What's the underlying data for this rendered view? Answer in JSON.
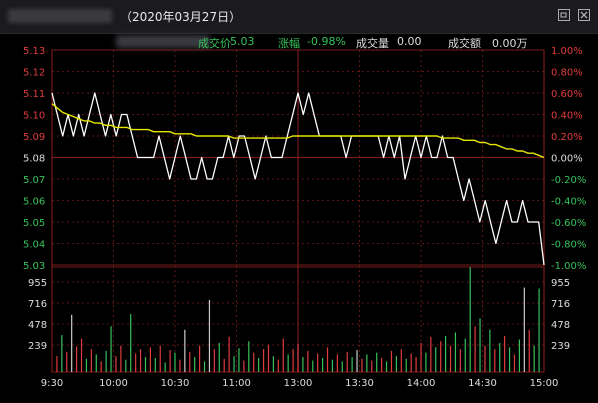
{
  "title": {
    "date_text": "（2020年03月27日）"
  },
  "window": {
    "restore_icon": "restore-icon",
    "close_icon": "close-icon"
  },
  "info": {
    "price_label": "成交价",
    "price_value": "5.03",
    "change_label": "涨幅",
    "change_value": "-0.98%",
    "volume_label": "成交量",
    "volume_value": "0.00",
    "amount_label": "成交额",
    "amount_value": "0.00万"
  },
  "colors": {
    "background": "#000000",
    "grid": "#7a1c1c",
    "up": "#e03c3c",
    "down": "#36c25a",
    "price_line": "#ffffff",
    "avg_line": "#e6e600",
    "neutral_text": "#dddddd"
  },
  "chart_data": {
    "type": "line",
    "prev_close": 5.08,
    "price_ticks": [
      "5.13",
      "5.12",
      "5.11",
      "5.10",
      "5.09",
      "5.08",
      "5.07",
      "5.06",
      "5.05",
      "5.04",
      "5.03"
    ],
    "pct_ticks": [
      "1.00%",
      "0.80%",
      "0.60%",
      "0.40%",
      "0.20%",
      "0.00%",
      "-0.20%",
      "-0.40%",
      "-0.60%",
      "-0.80%",
      "-1.00%"
    ],
    "volume_ticks": [
      "955",
      "716",
      "478",
      "239"
    ],
    "time_ticks": [
      "9:30",
      "10:00",
      "10:30",
      "11:00",
      "13:00",
      "13:30",
      "14:00",
      "14:30",
      "15:00"
    ],
    "ylim": [
      5.03,
      5.13
    ],
    "volume_max": 1194,
    "series": [
      {
        "key": "price",
        "values": [
          5.11,
          5.1,
          5.09,
          5.1,
          5.09,
          5.1,
          5.09,
          5.1,
          5.11,
          5.1,
          5.09,
          5.1,
          5.09,
          5.1,
          5.1,
          5.09,
          5.08,
          5.08,
          5.08,
          5.08,
          5.09,
          5.08,
          5.07,
          5.08,
          5.09,
          5.08,
          5.07,
          5.07,
          5.08,
          5.07,
          5.07,
          5.08,
          5.08,
          5.09,
          5.08,
          5.09,
          5.09,
          5.08,
          5.07,
          5.08,
          5.09,
          5.08,
          5.08,
          5.08,
          5.09,
          5.1,
          5.11,
          5.1,
          5.11,
          5.1,
          5.09,
          5.09,
          5.09,
          5.09,
          5.09,
          5.08,
          5.09,
          5.09,
          5.09,
          5.09,
          5.09,
          5.09,
          5.08,
          5.09,
          5.08,
          5.09,
          5.07,
          5.08,
          5.09,
          5.08,
          5.09,
          5.08,
          5.08,
          5.09,
          5.08,
          5.08,
          5.07,
          5.06,
          5.07,
          5.06,
          5.05,
          5.06,
          5.05,
          5.04,
          5.05,
          5.06,
          5.05,
          5.05,
          5.06,
          5.05,
          5.05,
          5.05,
          5.03
        ]
      },
      {
        "key": "avg",
        "values": [
          5.105,
          5.103,
          5.101,
          5.1,
          5.099,
          5.098,
          5.097,
          5.097,
          5.096,
          5.096,
          5.095,
          5.095,
          5.094,
          5.094,
          5.094,
          5.093,
          5.093,
          5.093,
          5.093,
          5.092,
          5.092,
          5.092,
          5.092,
          5.091,
          5.091,
          5.091,
          5.091,
          5.09,
          5.09,
          5.09,
          5.09,
          5.09,
          5.09,
          5.09,
          5.089,
          5.089,
          5.089,
          5.089,
          5.089,
          5.089,
          5.089,
          5.089,
          5.089,
          5.089,
          5.089,
          5.09,
          5.09,
          5.09,
          5.09,
          5.09,
          5.09,
          5.09,
          5.09,
          5.09,
          5.09,
          5.09,
          5.09,
          5.09,
          5.09,
          5.09,
          5.09,
          5.09,
          5.09,
          5.09,
          5.09,
          5.09,
          5.09,
          5.09,
          5.09,
          5.09,
          5.09,
          5.09,
          5.09,
          5.089,
          5.089,
          5.089,
          5.089,
          5.088,
          5.088,
          5.088,
          5.087,
          5.087,
          5.086,
          5.086,
          5.085,
          5.084,
          5.084,
          5.083,
          5.083,
          5.082,
          5.082,
          5.081,
          5.08
        ]
      }
    ],
    "volumes": [
      {
        "t": 0.01,
        "v": 180,
        "d": "u"
      },
      {
        "t": 0.02,
        "v": 420,
        "d": "d"
      },
      {
        "t": 0.03,
        "v": 230,
        "d": "u"
      },
      {
        "t": 0.04,
        "v": 650,
        "d": "n"
      },
      {
        "t": 0.05,
        "v": 290,
        "d": "u"
      },
      {
        "t": 0.06,
        "v": 380,
        "d": "u"
      },
      {
        "t": 0.07,
        "v": 150,
        "d": "d"
      },
      {
        "t": 0.08,
        "v": 260,
        "d": "u"
      },
      {
        "t": 0.09,
        "v": 200,
        "d": "d"
      },
      {
        "t": 0.1,
        "v": 120,
        "d": "u"
      },
      {
        "t": 0.11,
        "v": 240,
        "d": "d"
      },
      {
        "t": 0.12,
        "v": 520,
        "d": "d"
      },
      {
        "t": 0.13,
        "v": 180,
        "d": "u"
      },
      {
        "t": 0.14,
        "v": 300,
        "d": "u"
      },
      {
        "t": 0.15,
        "v": 140,
        "d": "d"
      },
      {
        "t": 0.16,
        "v": 660,
        "d": "d"
      },
      {
        "t": 0.17,
        "v": 210,
        "d": "u"
      },
      {
        "t": 0.18,
        "v": 260,
        "d": "u"
      },
      {
        "t": 0.19,
        "v": 170,
        "d": "d"
      },
      {
        "t": 0.2,
        "v": 280,
        "d": "u"
      },
      {
        "t": 0.21,
        "v": 160,
        "d": "d"
      },
      {
        "t": 0.22,
        "v": 300,
        "d": "u"
      },
      {
        "t": 0.23,
        "v": 110,
        "d": "d"
      },
      {
        "t": 0.24,
        "v": 250,
        "d": "u"
      },
      {
        "t": 0.25,
        "v": 220,
        "d": "d"
      },
      {
        "t": 0.26,
        "v": 140,
        "d": "u"
      },
      {
        "t": 0.27,
        "v": 480,
        "d": "n"
      },
      {
        "t": 0.28,
        "v": 230,
        "d": "u"
      },
      {
        "t": 0.29,
        "v": 170,
        "d": "d"
      },
      {
        "t": 0.3,
        "v": 300,
        "d": "u"
      },
      {
        "t": 0.31,
        "v": 120,
        "d": "d"
      },
      {
        "t": 0.32,
        "v": 820,
        "d": "n"
      },
      {
        "t": 0.33,
        "v": 260,
        "d": "u"
      },
      {
        "t": 0.34,
        "v": 330,
        "d": "d"
      },
      {
        "t": 0.35,
        "v": 150,
        "d": "u"
      },
      {
        "t": 0.36,
        "v": 400,
        "d": "u"
      },
      {
        "t": 0.37,
        "v": 180,
        "d": "d"
      },
      {
        "t": 0.38,
        "v": 270,
        "d": "d"
      },
      {
        "t": 0.39,
        "v": 130,
        "d": "u"
      },
      {
        "t": 0.4,
        "v": 350,
        "d": "d"
      },
      {
        "t": 0.41,
        "v": 220,
        "d": "u"
      },
      {
        "t": 0.42,
        "v": 160,
        "d": "d"
      },
      {
        "t": 0.43,
        "v": 260,
        "d": "u"
      },
      {
        "t": 0.44,
        "v": 310,
        "d": "u"
      },
      {
        "t": 0.45,
        "v": 180,
        "d": "d"
      },
      {
        "t": 0.46,
        "v": 140,
        "d": "u"
      },
      {
        "t": 0.47,
        "v": 380,
        "d": "u"
      },
      {
        "t": 0.48,
        "v": 200,
        "d": "d"
      },
      {
        "t": 0.49,
        "v": 260,
        "d": "u"
      },
      {
        "t": 0.5,
        "v": 320,
        "d": "u"
      },
      {
        "t": 0.51,
        "v": 170,
        "d": "d"
      },
      {
        "t": 0.52,
        "v": 240,
        "d": "u"
      },
      {
        "t": 0.53,
        "v": 130,
        "d": "d"
      },
      {
        "t": 0.54,
        "v": 210,
        "d": "u"
      },
      {
        "t": 0.55,
        "v": 160,
        "d": "d"
      },
      {
        "t": 0.56,
        "v": 280,
        "d": "u"
      },
      {
        "t": 0.57,
        "v": 140,
        "d": "d"
      },
      {
        "t": 0.58,
        "v": 200,
        "d": "u"
      },
      {
        "t": 0.59,
        "v": 120,
        "d": "d"
      },
      {
        "t": 0.6,
        "v": 230,
        "d": "u"
      },
      {
        "t": 0.61,
        "v": 170,
        "d": "d"
      },
      {
        "t": 0.62,
        "v": 250,
        "d": "n"
      },
      {
        "t": 0.63,
        "v": 150,
        "d": "u"
      },
      {
        "t": 0.64,
        "v": 200,
        "d": "d"
      },
      {
        "t": 0.65,
        "v": 130,
        "d": "u"
      },
      {
        "t": 0.66,
        "v": 220,
        "d": "d"
      },
      {
        "t": 0.67,
        "v": 160,
        "d": "u"
      },
      {
        "t": 0.68,
        "v": 120,
        "d": "d"
      },
      {
        "t": 0.69,
        "v": 240,
        "d": "u"
      },
      {
        "t": 0.7,
        "v": 180,
        "d": "d"
      },
      {
        "t": 0.71,
        "v": 260,
        "d": "u"
      },
      {
        "t": 0.72,
        "v": 150,
        "d": "d"
      },
      {
        "t": 0.73,
        "v": 210,
        "d": "u"
      },
      {
        "t": 0.74,
        "v": 170,
        "d": "u"
      },
      {
        "t": 0.75,
        "v": 330,
        "d": "u"
      },
      {
        "t": 0.76,
        "v": 220,
        "d": "d"
      },
      {
        "t": 0.77,
        "v": 400,
        "d": "u"
      },
      {
        "t": 0.78,
        "v": 280,
        "d": "d"
      },
      {
        "t": 0.79,
        "v": 350,
        "d": "u"
      },
      {
        "t": 0.8,
        "v": 410,
        "d": "d"
      },
      {
        "t": 0.81,
        "v": 300,
        "d": "u"
      },
      {
        "t": 0.82,
        "v": 450,
        "d": "d"
      },
      {
        "t": 0.83,
        "v": 260,
        "d": "u"
      },
      {
        "t": 0.84,
        "v": 380,
        "d": "d"
      },
      {
        "t": 0.85,
        "v": 1190,
        "d": "d"
      },
      {
        "t": 0.86,
        "v": 520,
        "d": "u"
      },
      {
        "t": 0.87,
        "v": 610,
        "d": "d"
      },
      {
        "t": 0.88,
        "v": 300,
        "d": "u"
      },
      {
        "t": 0.89,
        "v": 480,
        "d": "d"
      },
      {
        "t": 0.9,
        "v": 260,
        "d": "u"
      },
      {
        "t": 0.91,
        "v": 330,
        "d": "d"
      },
      {
        "t": 0.92,
        "v": 410,
        "d": "u"
      },
      {
        "t": 0.93,
        "v": 280,
        "d": "d"
      },
      {
        "t": 0.94,
        "v": 200,
        "d": "u"
      },
      {
        "t": 0.95,
        "v": 370,
        "d": "d"
      },
      {
        "t": 0.96,
        "v": 960,
        "d": "n"
      },
      {
        "t": 0.97,
        "v": 480,
        "d": "u"
      },
      {
        "t": 0.98,
        "v": 300,
        "d": "d"
      },
      {
        "t": 0.99,
        "v": 950,
        "d": "d"
      }
    ]
  }
}
